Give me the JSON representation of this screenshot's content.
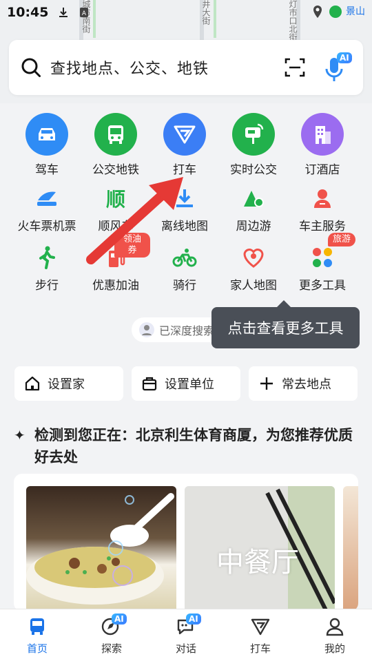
{
  "status_bar": {
    "time": "10:45"
  },
  "map": {
    "labels": [
      "城市南街",
      "井大街",
      "灯市口北街",
      "景山"
    ]
  },
  "search": {
    "placeholder": "查找地点、公交、地铁",
    "ai_badge": "AI"
  },
  "grid_row1": [
    {
      "label": "驾车",
      "icon": "car-icon",
      "color": "#2f8cf5"
    },
    {
      "label": "公交地铁",
      "icon": "bus-icon",
      "color": "#22b14c"
    },
    {
      "label": "打车",
      "icon": "taxi-icon",
      "color": "#3b7ef5"
    },
    {
      "label": "实时公交",
      "icon": "realtime-bus-icon",
      "color": "#22b14c"
    },
    {
      "label": "订酒店",
      "icon": "hotel-icon",
      "color": "#9b6cf0"
    }
  ],
  "grid_row2": [
    {
      "label": "火车票机票",
      "icon": "train-icon"
    },
    {
      "label": "顺风车",
      "icon": "shunfeng-icon",
      "glyph": "顺"
    },
    {
      "label": "离线地图",
      "icon": "offline-map-icon"
    },
    {
      "label": "周边游",
      "icon": "nearby-travel-icon"
    },
    {
      "label": "车主服务",
      "icon": "car-owner-icon"
    }
  ],
  "grid_row3": [
    {
      "label": "步行",
      "icon": "walk-icon"
    },
    {
      "label": "优惠加油",
      "icon": "fuel-icon",
      "tag": "领油券"
    },
    {
      "label": "骑行",
      "icon": "bike-icon"
    },
    {
      "label": "家人地图",
      "icon": "family-map-icon"
    },
    {
      "label": "更多工具",
      "icon": "more-tools-icon",
      "tag": "旅游"
    }
  ],
  "deep_search": {
    "text": "已深度搜索"
  },
  "tooltip": {
    "text": "点击查看更多工具"
  },
  "quick": {
    "home": "设置家",
    "work": "设置单位",
    "frequent": "常去地点"
  },
  "recommend": {
    "title": "检测到您正在：北京利生体育商厦，为您推荐优质好去处",
    "card2_label": "中餐厅"
  },
  "nav": [
    {
      "label": "首页",
      "icon": "home-bus-icon"
    },
    {
      "label": "探索",
      "icon": "explore-icon",
      "badge": "AI"
    },
    {
      "label": "对话",
      "icon": "chat-icon",
      "badge": "AI"
    },
    {
      "label": "打车",
      "icon": "taxi-nav-icon"
    },
    {
      "label": "我的",
      "icon": "profile-icon"
    }
  ],
  "colors": {
    "accent": "#1a73e8",
    "green": "#22b14c",
    "red_tag": "#f0524a"
  }
}
